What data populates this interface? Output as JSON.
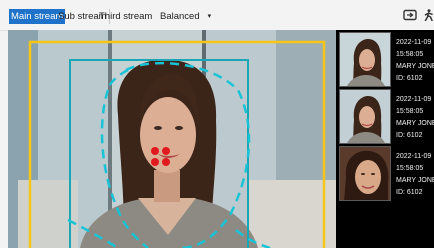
{
  "toolbar": {
    "tabs": [
      {
        "label": "Main stream",
        "active": true
      },
      {
        "label": "Sub stream",
        "active": false
      },
      {
        "label": "Third stream",
        "active": false
      }
    ],
    "quality": {
      "label": "Balanced",
      "chevron": "▾"
    },
    "icons": [
      "snapshot-icon",
      "walking-person-icon"
    ]
  },
  "colors": {
    "accent": "#1f72c9",
    "detect_box": "#f5c518",
    "face_box": "#19a7b6",
    "landmarks": "#e0191e",
    "panel_bg": "#000000"
  },
  "captures": [
    {
      "date": "2022-11-09",
      "time": "15:58:05",
      "name": "MARY JONES",
      "id": "ID: 6102"
    },
    {
      "date": "2022-11-09",
      "time": "15:58:05",
      "name": "MARY JONES",
      "id": "ID: 6102"
    },
    {
      "date": "2022-11-09",
      "time": "15:58:05",
      "name": "MARY JONES",
      "id": "ID: 6102"
    }
  ]
}
